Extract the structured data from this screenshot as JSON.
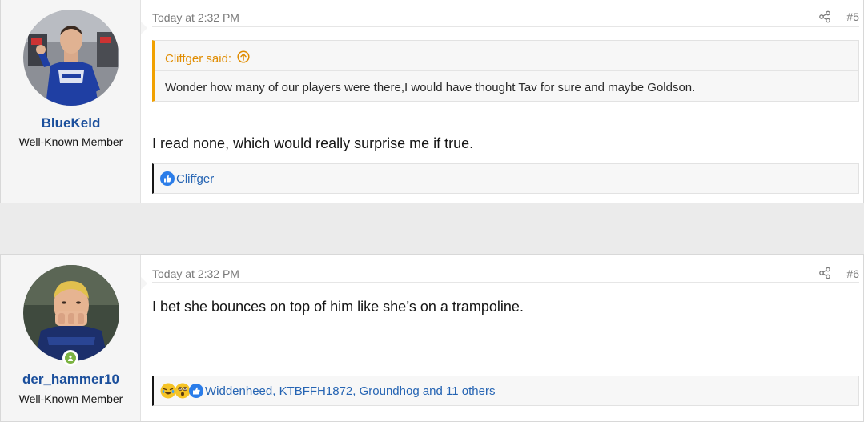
{
  "posts": [
    {
      "username": "BlueKeld",
      "user_title": "Well-Known Member",
      "date": "Today at 2:32 PM",
      "post_number": "#5",
      "quote": {
        "author": "Cliffger said:",
        "text": "Wonder how many of our players were there,I would have thought Tav for sure and maybe Goldson."
      },
      "body": "I read none, which would really surprise me if true.",
      "reactions": {
        "icons": [
          "like-icon"
        ],
        "names": "Cliffger"
      }
    },
    {
      "username": "der_hammer10",
      "user_title": "Well-Known Member",
      "date": "Today at 2:32 PM",
      "post_number": "#6",
      "online": true,
      "body": "I bet she bounces on top of him like she’s on a trampoline.",
      "reactions": {
        "icons": [
          "haha-icon",
          "wow-icon",
          "like-icon"
        ],
        "names": "Widdenheed, KTBFFH1872, Groundhog and 11 others"
      }
    }
  ],
  "colors": {
    "username": "#1b4f9c",
    "quote_accent": "#f1a100",
    "link": "#2564b3",
    "online": "#7cb342"
  }
}
